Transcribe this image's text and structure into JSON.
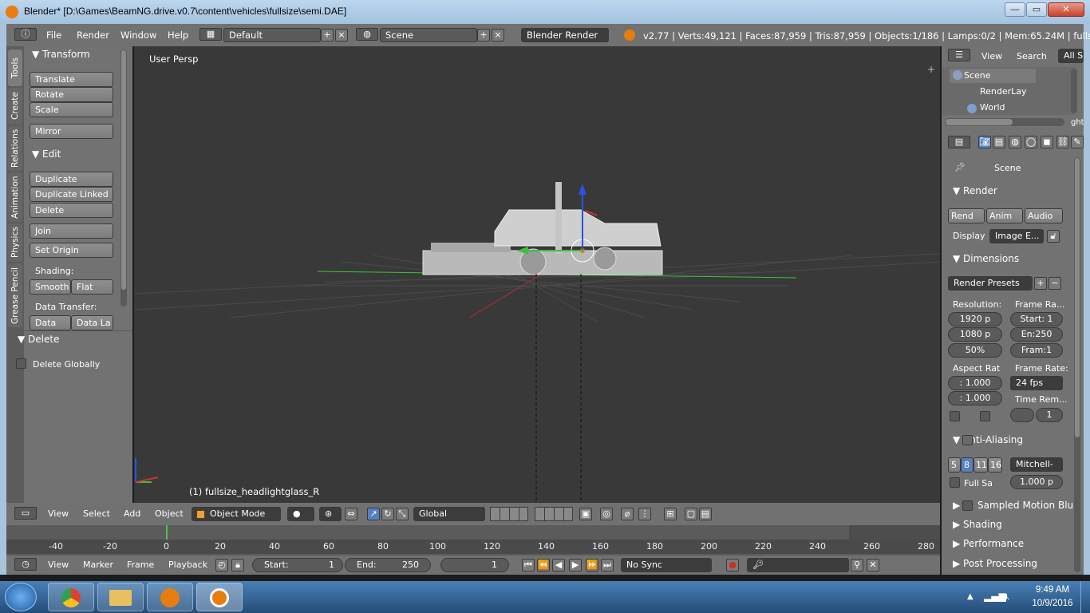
{
  "window": {
    "title": "Blender* [D:\\Games\\BeamNG.drive.v0.7\\content\\vehicles\\fullsize\\semi.DAE]",
    "min": "—",
    "max": "▭",
    "close": "✕"
  },
  "menubar": {
    "file": "File",
    "render": "Render",
    "window": "Window",
    "help": "Help",
    "layout": "Default",
    "scene": "Scene",
    "engine": "Blender Render",
    "stats": "v2.77 | Verts:49,121 | Faces:87,959 | Tris:87,959 | Objects:1/186 | Lamps:0/2 | Mem:65.24M | fullsize_headli"
  },
  "tool_tabs": [
    "Tools",
    "Create",
    "Relations",
    "Animation",
    "Physics",
    "Grease Pencil"
  ],
  "tools": {
    "transform": {
      "header": "Transform",
      "translate": "Translate",
      "rotate": "Rotate",
      "scale": "Scale",
      "mirror": "Mirror"
    },
    "edit": {
      "header": "Edit",
      "duplicate": "Duplicate",
      "duplicate_linked": "Duplicate Linked",
      "delete": "Delete",
      "join": "Join",
      "set_origin": "Set Origin",
      "shading_label": "Shading:",
      "smooth": "Smooth",
      "flat": "Flat",
      "data_transfer_label": "Data Transfer:",
      "data": "Data",
      "data_la": "Data La"
    },
    "delete_panel": {
      "header": "Delete",
      "delete_globally": "Delete Globally"
    }
  },
  "viewport": {
    "view_name": "User Persp",
    "object_label": "(1) fullsize_headlightglass_R"
  },
  "header3d": {
    "view": "View",
    "select": "Select",
    "add": "Add",
    "object": "Object",
    "mode": "Object Mode",
    "orientation": "Global"
  },
  "timeline": {
    "ticks": [
      "-40",
      "-20",
      "0",
      "20",
      "40",
      "60",
      "80",
      "100",
      "120",
      "140",
      "160",
      "180",
      "200",
      "220",
      "240",
      "260",
      "280"
    ],
    "view": "View",
    "marker": "Marker",
    "frame": "Frame",
    "playback": "Playback",
    "start_label": "Start:",
    "start": "1",
    "end_label": "End:",
    "end": "250",
    "current": "1",
    "sync": "No Sync"
  },
  "outliner": {
    "view": "View",
    "search": "Search",
    "all_scenes": "All Sc",
    "items": [
      "Scene",
      "RenderLay",
      "World"
    ],
    "overflow": "ght"
  },
  "properties": {
    "context": "Scene",
    "render": {
      "header": "Render",
      "rend": "Rend",
      "anim": "Anim",
      "audio": "Audio",
      "display_label": "Display",
      "display": "Image E..."
    },
    "dimensions": {
      "header": "Dimensions",
      "presets": "Render Presets",
      "resolution_label": "Resolution:",
      "res_x": "1920 p",
      "res_y": "1080 p",
      "res_pct": "50%",
      "frame_range_label": "Frame Ra...",
      "start": "Start: 1",
      "end": "En:250",
      "step": "Fram:1",
      "aspect_label": "Aspect Rat",
      "aspect_x": ": 1.000",
      "aspect_y": ": 1.000",
      "fps_label": "Frame Rate:",
      "fps": "24 fps",
      "time_remap_label": "Time Rem...",
      "time_remap": "1"
    },
    "antialiasing": {
      "header": "Anti-Aliasing",
      "samples": [
        "5",
        "8",
        "11",
        "16"
      ],
      "filter": "Mitchell-",
      "full_sample": "Full Sa",
      "filter_size": "1.000 p"
    },
    "collapsed": [
      "Sampled Motion Blur",
      "Shading",
      "Performance",
      "Post Processing"
    ]
  },
  "taskbar": {
    "time": "9:49 AM",
    "date": "10/9/2016"
  },
  "colors": {
    "accent": "#5680c2",
    "blender_orange": "#e87d0d",
    "x_axis": "#cc3333",
    "y_axis": "#3fbf3f",
    "z_axis": "#3050e0"
  }
}
